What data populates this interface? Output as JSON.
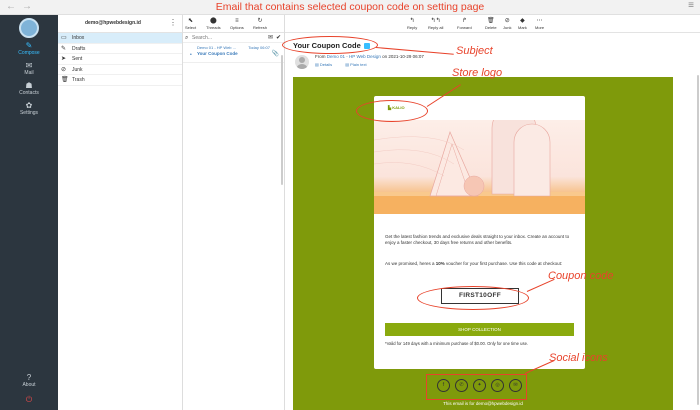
{
  "browser": {
    "back": "←",
    "forward": "→",
    "caption": "Email that contains selected coupon code on setting page",
    "menu": "≡"
  },
  "rail": {
    "items": [
      {
        "label": "Compose",
        "icon": "compose-icon",
        "glyph": "✎"
      },
      {
        "label": "Mail",
        "icon": "mail-icon",
        "glyph": "✉"
      },
      {
        "label": "Contacts",
        "icon": "contacts-icon",
        "glyph": "☗"
      },
      {
        "label": "Settings",
        "icon": "settings-icon",
        "glyph": "✿"
      },
      {
        "label": "About",
        "icon": "about-icon",
        "glyph": "?"
      },
      {
        "label": "",
        "icon": "logout-icon",
        "glyph": "⏻"
      }
    ]
  },
  "folders": {
    "account": "demo@hpwebdesign.id",
    "menu_glyph": "⋮",
    "items": [
      {
        "label": "Inbox",
        "glyph": "▭"
      },
      {
        "label": "Drafts",
        "glyph": "✎"
      },
      {
        "label": "Sent",
        "glyph": "➤"
      },
      {
        "label": "Junk",
        "glyph": "⊘"
      },
      {
        "label": "Trash",
        "glyph": "🗑"
      }
    ]
  },
  "list": {
    "tools": [
      {
        "label": "Select",
        "glyph": "⬉"
      },
      {
        "label": "Threads",
        "glyph": "⬤"
      },
      {
        "label": "Options",
        "glyph": "≡"
      },
      {
        "label": "Refresh",
        "glyph": "↻"
      }
    ],
    "search_placeholder": "Search...",
    "search_glyph": "⌕",
    "envelope_glyph": "✉",
    "check_glyph": "✔",
    "message": {
      "from": "Demo 01 - HP Web ...",
      "date": "Today 06:07",
      "subject": "Your Coupon Code",
      "dot": "•",
      "clip": "📎"
    }
  },
  "reader": {
    "tools": [
      {
        "label": "Reply",
        "glyph": "↰"
      },
      {
        "label": "Reply all",
        "glyph": "↰↰"
      },
      {
        "label": "Forward",
        "glyph": "↱"
      },
      {
        "label": "Delete",
        "glyph": "🗑"
      },
      {
        "label": "Junk",
        "glyph": "⊘"
      },
      {
        "label": "Mark",
        "glyph": "◆"
      },
      {
        "label": "More",
        "glyph": "⋯"
      }
    ],
    "subject": "Your Coupon Code",
    "from_prefix": "From",
    "from_name": "Demo 01 - HP Web Design",
    "from_suffix": "on 2021-10-29 06:07",
    "details": "Details",
    "plain_text": "Plain text"
  },
  "email": {
    "brand": "KALIO",
    "brand_sub": "",
    "paragraph1": "Get the latest fashion trends and exclusive deals straight to your inbox. Create an account to enjoy a faster checkout, 30 days free returns and other benefits.",
    "paragraph2_prefix": "As we promised, heres a ",
    "paragraph2_bold": "10%",
    "paragraph2_suffix": " voucher for your first purchase. Use this code at checkout:",
    "coupon_code": "FIRST10OFF",
    "shop_button": "SHOP COLLECTION",
    "validity": "*Valid for 149 days with a minimum purchase of $0.00. Only for one time use.",
    "footer": "This email is for demo@hpwebdesign.id",
    "social": [
      {
        "name": "facebook-icon",
        "glyph": "f"
      },
      {
        "name": "whatsapp-icon",
        "glyph": "✆"
      },
      {
        "name": "twitter-icon",
        "glyph": "✦"
      },
      {
        "name": "instagram-icon",
        "glyph": "◎"
      },
      {
        "name": "email-icon",
        "glyph": "✉"
      }
    ]
  },
  "annotations": {
    "subject": "Subject",
    "store_logo": "Store logo",
    "coupon_code": "Coupon code",
    "social_icons": "Social icons"
  },
  "colors": {
    "rail_bg": "#2c363f",
    "accent_blue": "#37beff",
    "email_green": "#7f9a0b",
    "annotation_red": "#e8432b"
  }
}
